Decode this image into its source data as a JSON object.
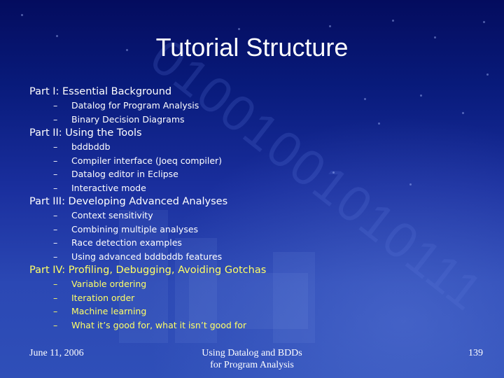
{
  "slide": {
    "title": "Tutorial Structure",
    "parts": [
      {
        "label": "Part I: Essential Background",
        "color": "#ffffff",
        "items": [
          "Datalog for Program Analysis",
          "Binary Decision Diagrams"
        ]
      },
      {
        "label": "Part II: Using the Tools",
        "color": "#ffffff",
        "items": [
          "bddbddb",
          "Compiler interface (Joeq compiler)",
          "Datalog editor in Eclipse",
          "Interactive mode"
        ]
      },
      {
        "label": "Part III: Developing Advanced Analyses",
        "color": "#ffffff",
        "items": [
          "Context sensitivity",
          "Combining multiple analyses",
          "Race detection examples",
          "Using advanced bddbddb features"
        ]
      },
      {
        "label": "Part IV: Profiling, Debugging, Avoiding Gotchas",
        "color": "#ffff66",
        "items": [
          "Variable ordering",
          "Iteration order",
          "Machine learning",
          "What it’s good for, what it isn’t good for"
        ]
      }
    ],
    "bullet": "–"
  },
  "footer": {
    "date": "June 11, 2006",
    "title_line1": "Using Datalog and BDDs",
    "title_line2": "for Program Analysis",
    "page_number": "139"
  },
  "background": {
    "decoration_text": "01001001010111"
  }
}
